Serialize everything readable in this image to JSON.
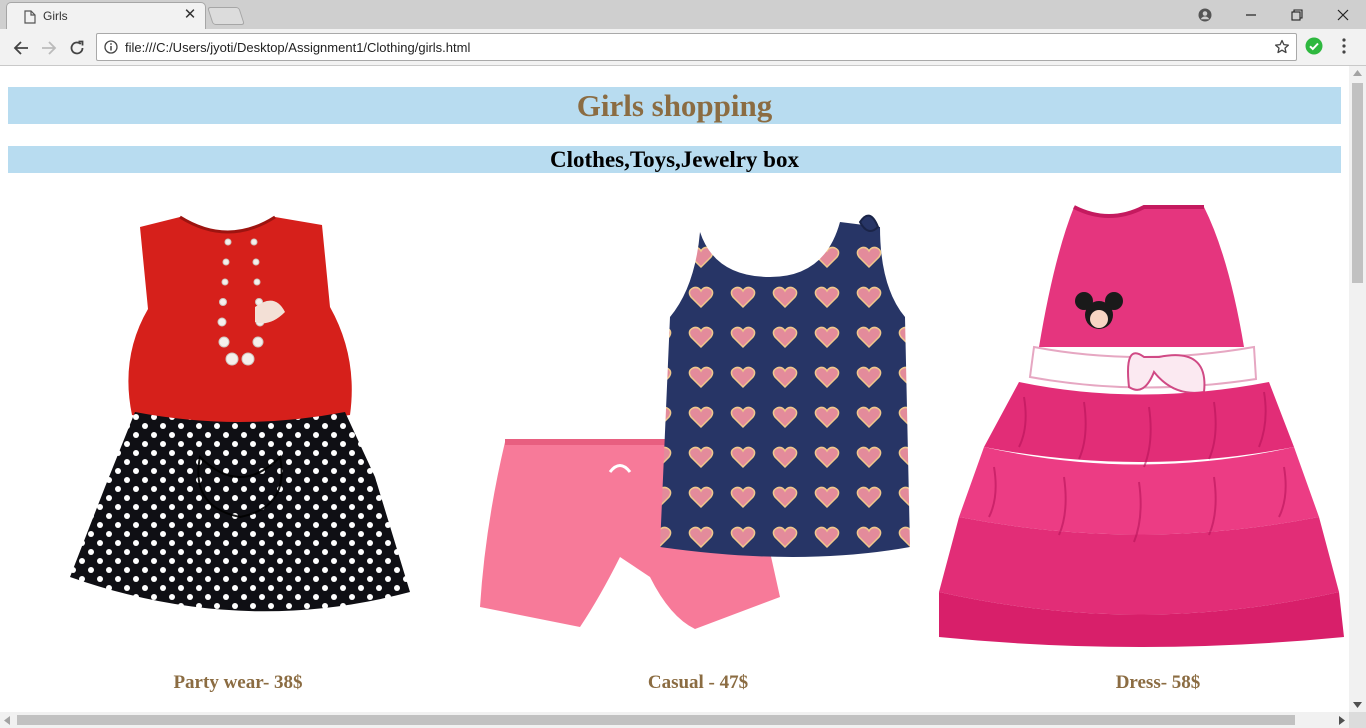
{
  "browser": {
    "tab_title": "Girls",
    "url": "file:///C:/Users/jyoti/Desktop/Assignment1/Clothing/girls.html"
  },
  "page": {
    "heading": "Girls shopping",
    "subheading": "Clothes,Toys,Jewelry box",
    "products": [
      {
        "caption": "Party wear- 38$",
        "image": "red-top-polka-dot-skirt-outfit"
      },
      {
        "caption": "Casual - 47$",
        "image": "heart-tank-top-pink-shorts-set"
      },
      {
        "caption": "Dress- 58$",
        "image": "pink-ruffled-minnie-dress"
      }
    ]
  },
  "colors": {
    "banner_bg": "#b8dcf0",
    "heading_text": "#8b6c42",
    "caption_text": "#8b6c42"
  }
}
